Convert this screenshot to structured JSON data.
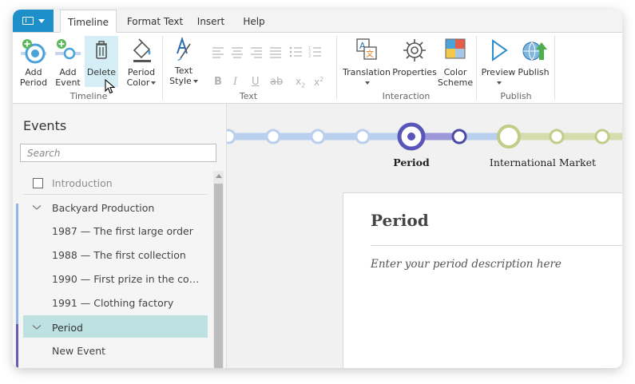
{
  "tabs": [
    "Timeline",
    "Format Text",
    "Insert",
    "Help"
  ],
  "ribbon": {
    "add_period": [
      "Add",
      "Period"
    ],
    "add_event": [
      "Add",
      "Event"
    ],
    "delete": "Delete",
    "period_color": [
      "Period",
      "Color"
    ],
    "text_style": [
      "Text",
      "Style"
    ],
    "translation": "Translation",
    "properties": "Properties",
    "color_scheme": [
      "Color",
      "Scheme"
    ],
    "preview": "Preview",
    "publish": "Publish",
    "groups": {
      "timeline": "Timeline",
      "text": "Text",
      "interaction": "Interaction",
      "publish": "Publish"
    },
    "format_icons": [
      "bold-icon",
      "italic-icon",
      "underline-icon",
      "strikethrough-icon",
      "subscript-icon",
      "superscript-icon"
    ]
  },
  "panel": {
    "title": "Events",
    "search_placeholder": "Search",
    "items": [
      {
        "label": "Introduction",
        "type": "checkbox"
      },
      {
        "label": "Backyard Production",
        "type": "group"
      },
      {
        "label": "1987 — The first large order",
        "type": "event"
      },
      {
        "label": "1988 — The first collection",
        "type": "event"
      },
      {
        "label": "1990 — First prize in the contest",
        "type": "event"
      },
      {
        "label": "1991 — Clothing factory",
        "type": "event"
      },
      {
        "label": "Period",
        "type": "group",
        "selected": true
      },
      {
        "label": "New Event",
        "type": "event"
      }
    ]
  },
  "timeline": {
    "labels": [
      "Period",
      "International Market"
    ],
    "colors": {
      "past": "#b8cfee",
      "period": "#5a55b8",
      "next": "#c2cc86"
    }
  },
  "card": {
    "title": "Period",
    "description": "Enter your period description here"
  },
  "colors": {
    "accent": "#1f8fc9",
    "selected_row": "#bee1e2",
    "group_bar_blue": "#8fb6e6",
    "group_bar_purple": "#6a5bb5"
  }
}
